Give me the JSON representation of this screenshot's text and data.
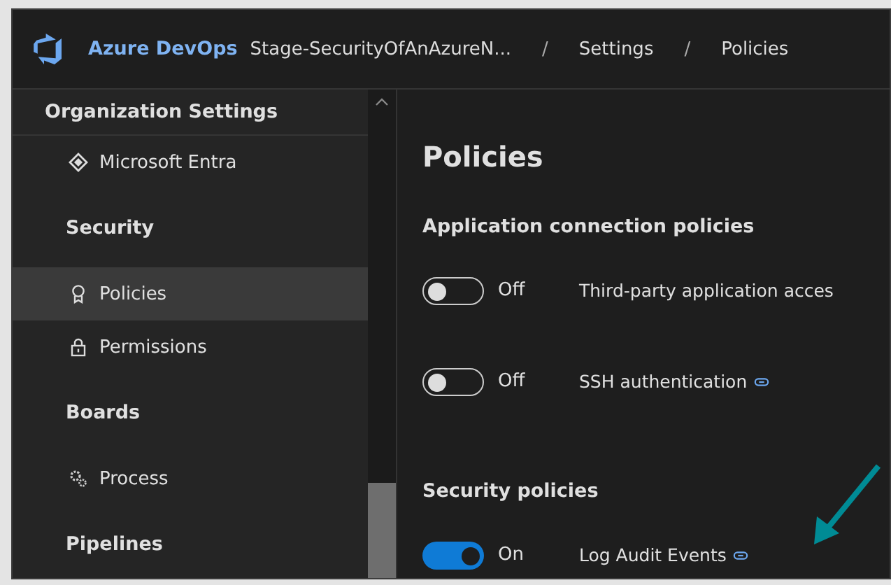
{
  "header": {
    "product": "Azure DevOps",
    "separator": "/",
    "breadcrumbs": [
      "Stage-SecurityOfAnAzureN...",
      "Settings",
      "Policies"
    ]
  },
  "sidebar": {
    "title": "Organization Settings",
    "items": [
      {
        "kind": "item",
        "label": "Microsoft Entra",
        "selected": false
      },
      {
        "kind": "section",
        "label": "Security"
      },
      {
        "kind": "item",
        "label": "Policies",
        "selected": true
      },
      {
        "kind": "item",
        "label": "Permissions",
        "selected": false
      },
      {
        "kind": "section",
        "label": "Boards"
      },
      {
        "kind": "item",
        "label": "Process",
        "selected": false
      },
      {
        "kind": "section",
        "label": "Pipelines"
      }
    ]
  },
  "content": {
    "title": "Policies",
    "sections": [
      {
        "heading": "Application connection policies",
        "policies": [
          {
            "on": false,
            "state_label": "Off",
            "name": "Third-party application acces",
            "link": false
          },
          {
            "on": false,
            "state_label": "Off",
            "name": "SSH authentication",
            "link": true
          }
        ]
      },
      {
        "heading": "Security policies",
        "policies": [
          {
            "on": true,
            "state_label": "On",
            "name": "Log Audit Events",
            "link": true
          }
        ]
      }
    ]
  }
}
